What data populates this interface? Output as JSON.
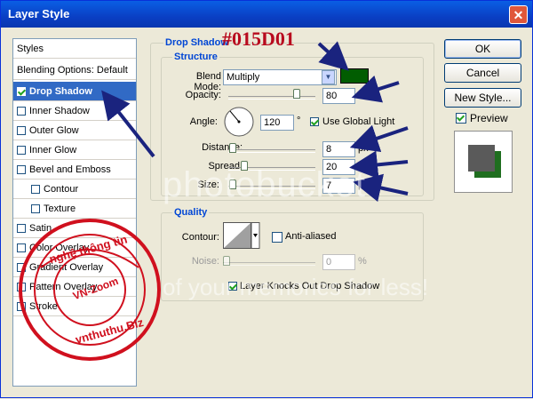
{
  "window": {
    "title": "Layer Style",
    "close_label": "✕"
  },
  "styles_panel": {
    "items": [
      {
        "label": "Styles",
        "checkbox": false,
        "checked": false,
        "indent": 0
      },
      {
        "label": "Blending Options: Default",
        "checkbox": false,
        "checked": false,
        "indent": 0
      },
      {
        "label": "Drop Shadow",
        "checkbox": true,
        "checked": true,
        "indent": 0,
        "selected": true
      },
      {
        "label": "Inner Shadow",
        "checkbox": true,
        "checked": false,
        "indent": 0
      },
      {
        "label": "Outer Glow",
        "checkbox": true,
        "checked": false,
        "indent": 0
      },
      {
        "label": "Inner Glow",
        "checkbox": true,
        "checked": false,
        "indent": 0
      },
      {
        "label": "Bevel and Emboss",
        "checkbox": true,
        "checked": false,
        "indent": 0
      },
      {
        "label": "Contour",
        "checkbox": true,
        "checked": false,
        "indent": 1
      },
      {
        "label": "Texture",
        "checkbox": true,
        "checked": false,
        "indent": 1
      },
      {
        "label": "Satin",
        "checkbox": true,
        "checked": false,
        "indent": 0
      },
      {
        "label": "Color Overlay",
        "checkbox": true,
        "checked": false,
        "indent": 0
      },
      {
        "label": "Gradient Overlay",
        "checkbox": true,
        "checked": false,
        "indent": 0
      },
      {
        "label": "Pattern Overlay",
        "checkbox": true,
        "checked": false,
        "indent": 0
      },
      {
        "label": "Stroke",
        "checkbox": true,
        "checked": false,
        "indent": 0
      }
    ]
  },
  "drop_shadow": {
    "group_title": "Drop Shadow",
    "structure_title": "Structure",
    "blend_mode_label": "Blend Mode:",
    "blend_mode_value": "Multiply",
    "shadow_color": "#015D01",
    "opacity_label": "Opacity:",
    "opacity_value": "80",
    "opacity_unit": "%",
    "angle_label": "Angle:",
    "angle_value": "120",
    "angle_unit": "°",
    "use_global_light_label": "Use Global Light",
    "use_global_light_checked": true,
    "distance_label": "Distance:",
    "distance_value": "8",
    "distance_unit": "px",
    "spread_label": "Spread:",
    "spread_value": "20",
    "spread_unit": "%",
    "size_label": "Size:",
    "size_value": "7",
    "size_unit": "px"
  },
  "quality": {
    "title": "Quality",
    "contour_label": "Contour:",
    "anti_aliased_label": "Anti-aliased",
    "anti_aliased_checked": false,
    "noise_label": "Noise:",
    "noise_value": "0",
    "noise_unit": "%",
    "knocks_out_label": "Layer Knocks Out Drop Shadow",
    "knocks_out_checked": true
  },
  "buttons": {
    "ok": "OK",
    "cancel": "Cancel",
    "new_style": "New Style...",
    "preview_label": "Preview",
    "preview_checked": true
  },
  "annotation": {
    "color_code": "#015D01"
  },
  "watermark": {
    "text": "photobucket",
    "text2": "of your memories for less!"
  },
  "stamp": {
    "text_top": "nghệ thông tin",
    "text_side": "Công nghệ thông tin",
    "text_center": "VN-Zoom",
    "text_bottom": "vnthuthu.Biz"
  },
  "colors": {
    "title_bar": "#0a4fd6",
    "selection": "#316ac5",
    "annotation_red": "#b80a1e",
    "arrow_blue": "#1a237e",
    "stamp_red": "#d0101e"
  }
}
